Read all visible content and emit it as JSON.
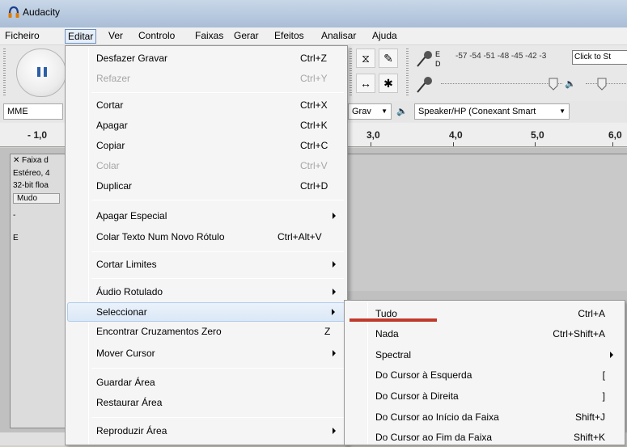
{
  "window": {
    "title": "Audacity",
    "accent": "#2b5fa8",
    "annotation_color": "#c0392b"
  },
  "menubar": {
    "items": [
      "Ficheiro",
      "Editar",
      "Ver",
      "Controlo",
      "Faixas",
      "Gerar",
      "Efeitos",
      "Analisar",
      "Ajuda"
    ],
    "open": "Editar"
  },
  "toolbar": {
    "meter_scale": "-57 -54 -51 -48 -45 -42 -3",
    "meter_prompt": "Click to St",
    "host": "MME",
    "record_device": "Grav",
    "playback_device": "Speaker/HP (Conexant Smart",
    "meter_labels": [
      "E",
      "D"
    ]
  },
  "ruler": {
    "labels": [
      "- 1,0",
      "3,0",
      "4,0",
      "5,0",
      "6,0"
    ]
  },
  "track": {
    "name": "Faixa d",
    "info1": "Estéreo, 4",
    "info2": "32-bit floa",
    "mute": "Mudo",
    "gain_minus": "-",
    "pan_left": "E"
  },
  "edit_menu": {
    "items": [
      {
        "label": "Desfazer Gravar",
        "shortcut": "Ctrl+Z"
      },
      {
        "label": "Refazer",
        "shortcut": "Ctrl+Y",
        "disabled": true
      },
      {
        "label": "Cortar",
        "shortcut": "Ctrl+X"
      },
      {
        "label": "Apagar",
        "shortcut": "Ctrl+K"
      },
      {
        "label": "Copiar",
        "shortcut": "Ctrl+C"
      },
      {
        "label": "Colar",
        "shortcut": "Ctrl+V",
        "disabled": true
      },
      {
        "label": "Duplicar",
        "shortcut": "Ctrl+D"
      },
      {
        "label": "Apagar Especial",
        "shortcut": ""
      },
      {
        "label": "Colar Texto Num Novo Rótulo",
        "shortcut": "Ctrl+Alt+V"
      },
      {
        "label": "Cortar Limites",
        "shortcut": ""
      },
      {
        "label": "Áudio Rotulado",
        "shortcut": ""
      },
      {
        "label": "Seleccionar",
        "shortcut": ""
      },
      {
        "label": "Encontrar Cruzamentos Zero",
        "shortcut": "Z"
      },
      {
        "label": "Mover Cursor",
        "shortcut": ""
      },
      {
        "label": "Guardar Área",
        "shortcut": ""
      },
      {
        "label": "Restaurar Área",
        "shortcut": ""
      },
      {
        "label": "Reproduzir Área",
        "shortcut": ""
      }
    ]
  },
  "select_submenu": {
    "items": [
      {
        "label": "Tudo",
        "shortcut": "Ctrl+A"
      },
      {
        "label": "Nada",
        "shortcut": "Ctrl+Shift+A"
      },
      {
        "label": "Spectral",
        "shortcut": ""
      },
      {
        "label": "Do Cursor à Esquerda",
        "shortcut": "["
      },
      {
        "label": "Do Cursor à Direita",
        "shortcut": "]"
      },
      {
        "label": "Do Cursor ao Início da Faixa",
        "shortcut": "Shift+J"
      },
      {
        "label": "Do Cursor ao Fim da Faixa",
        "shortcut": "Shift+K"
      }
    ]
  }
}
